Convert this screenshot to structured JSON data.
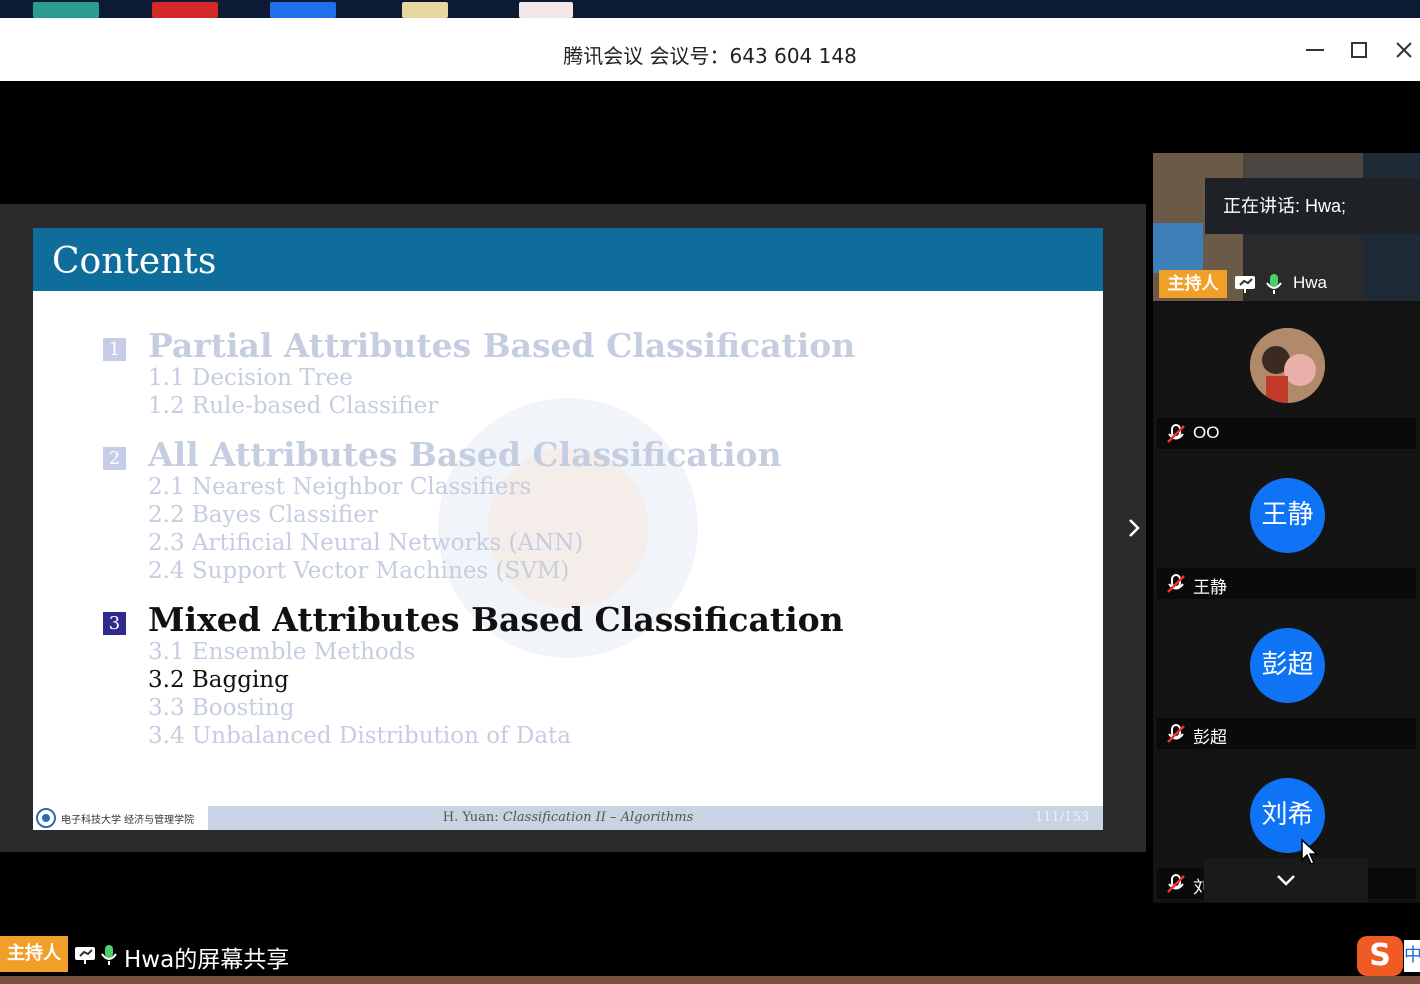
{
  "window": {
    "title": "腾讯会议 会议号：643 604 148"
  },
  "slide": {
    "title": "Contents",
    "sections": [
      {
        "number": "1",
        "title": "Partial Attributes Based Classification",
        "state": "faded",
        "items": [
          "1.1 Decision Tree",
          "1.2 Rule-based Classifier"
        ]
      },
      {
        "number": "2",
        "title": "All Attributes Based Classification",
        "state": "faded",
        "items": [
          "2.1 Nearest Neighbor Classifiers",
          "2.2 Bayes Classifier",
          "2.3 Artificial Neural Networks (ANN)",
          "2.4 Support Vector Machines (SVM)"
        ]
      },
      {
        "number": "3",
        "title": "Mixed Attributes Based Classification",
        "state": "active",
        "items": [
          "3.1 Ensemble Methods",
          "3.2 Bagging",
          "3.3 Boosting",
          "3.4 Unbalanced Distribution of Data"
        ],
        "active_item_index": 1
      }
    ],
    "footer": {
      "institution": "电子科技大学 经济与管理学院",
      "center_author": "H. Yuan: ",
      "center_title": "Classification II – Algorithms",
      "page": "111/153"
    }
  },
  "speaker": {
    "speaking_label": "正在讲话: Hwa;",
    "host_badge": "主持人",
    "name": "Hwa"
  },
  "participants": [
    {
      "name": "OO",
      "avatar_text": "",
      "muted": true
    },
    {
      "name": "王静",
      "avatar_text": "王静",
      "muted": true
    },
    {
      "name": "彭超",
      "avatar_text": "彭超",
      "muted": true
    },
    {
      "name": "刘希",
      "avatar_text": "刘希",
      "muted": true
    }
  ],
  "bottom": {
    "host_badge": "主持人",
    "share_label": "Hwa的屏幕共享"
  },
  "ime": {
    "icon": "S",
    "mode": "中"
  },
  "colors": {
    "accent_blue": "#0e73f5",
    "host_orange": "#f0a028",
    "slide_header": "#0f6d9c"
  }
}
